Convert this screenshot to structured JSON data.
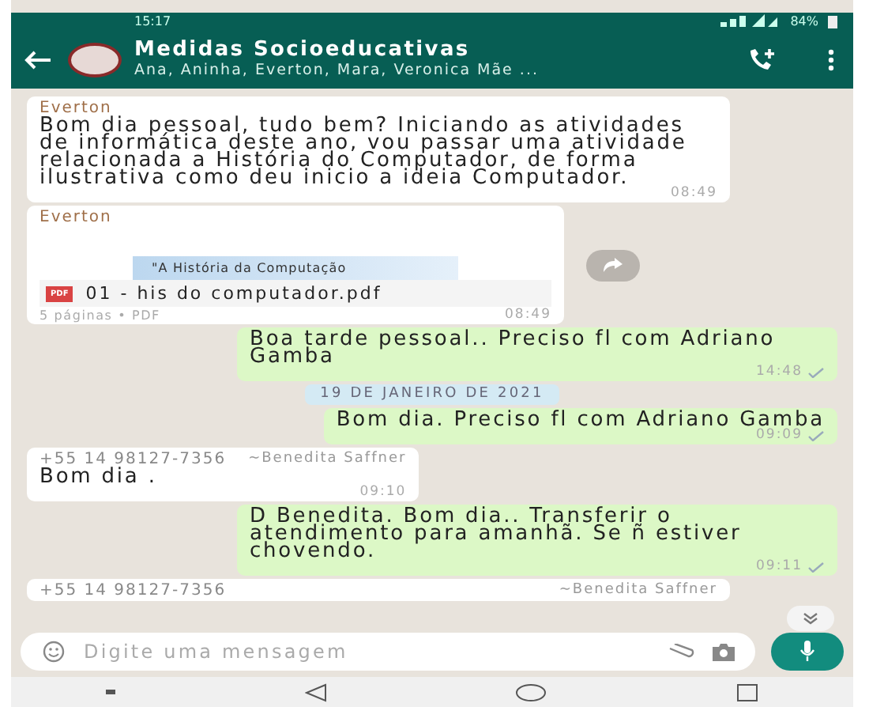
{
  "status_bar": {
    "time": "15:17",
    "battery": "84%"
  },
  "header": {
    "title": "Medidas Socioeducativas",
    "subtitle": "Ana, Aninha, Everton, Mara, Veronica Mãe ..."
  },
  "messages": [
    {
      "kind": "text",
      "outgoing": false,
      "sender": "Everton",
      "text": "Bom dia pessoal, tudo bem? Iniciando as atividades de informática deste ano, vou passar uma atividade relacionada a História do Computador, de forma ilustrativa como deu inicio a ideia Computador.",
      "time": "08:49"
    },
    {
      "kind": "document",
      "outgoing": false,
      "sender": "Everton",
      "preview_title": "\"A História da Computação",
      "badge": "PDF",
      "filename": "01 - his do computador.pdf",
      "meta": "5 páginas • PDF",
      "time": "08:49"
    },
    {
      "kind": "text",
      "outgoing": true,
      "text": "Boa tarde pessoal.. Preciso fl com Adriano Gamba",
      "time": "14:48"
    },
    {
      "kind": "date",
      "text": "19 DE JANEIRO DE 2021"
    },
    {
      "kind": "text",
      "outgoing": true,
      "text": "Bom dia. Preciso fl com Adriano Gamba",
      "time": "09:09"
    },
    {
      "kind": "text",
      "outgoing": false,
      "phone": "+55 14 98127-7356",
      "sender": "~Benedita Saffner",
      "text": "Bom dia .",
      "time": "09:10"
    },
    {
      "kind": "text",
      "outgoing": true,
      "text": "D Benedita. Bom dia.. Transferir o atendimento para amanhã. Se ñ estiver chovendo.",
      "time": "09:11"
    },
    {
      "kind": "partial",
      "outgoing": false,
      "phone": "+55 14 98127-7356",
      "sender": "~Benedita Saffner"
    }
  ],
  "input": {
    "placeholder": "Digite uma mensagem"
  }
}
